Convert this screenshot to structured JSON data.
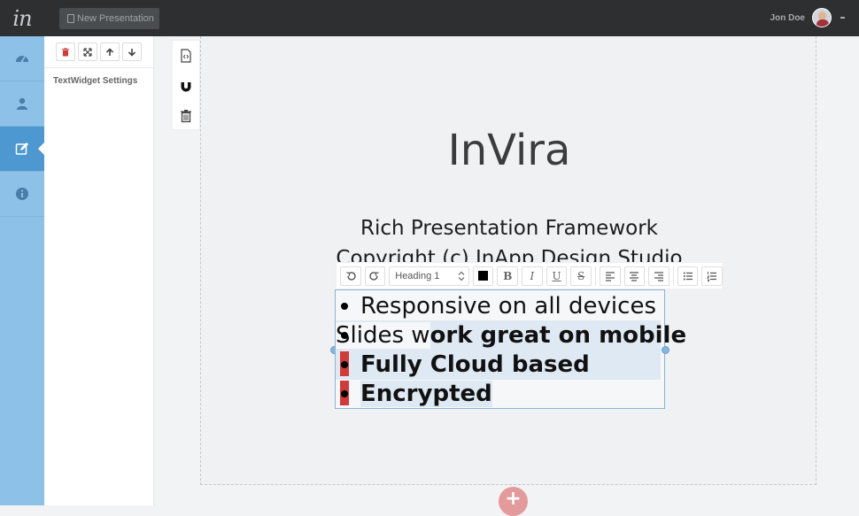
{
  "app": {
    "logo_text": "in"
  },
  "topbar": {
    "new_presentation_label": "New Presentation",
    "user_name": "Jon Doe"
  },
  "nav": {
    "items": [
      {
        "icon": "dashboard-icon"
      },
      {
        "icon": "user-icon"
      },
      {
        "icon": "edit-icon",
        "active": true
      },
      {
        "icon": "info-icon"
      }
    ]
  },
  "settings": {
    "title": "TextWidget Settings"
  },
  "slide": {
    "title": "InVira",
    "subtitle_1": "Rich Presentation Framework",
    "subtitle_2": "Copyright (c) InApp Design Studio"
  },
  "editor": {
    "block_style": "Heading 1",
    "text_color": "#000000",
    "list": [
      {
        "normal": "Responsive on all devices",
        "bold": ""
      },
      {
        "normal": "Slides w",
        "bold": "ork great on mobile"
      },
      {
        "normal": "",
        "bold": "Fully Cloud based"
      },
      {
        "normal": "",
        "bold": "Encrypted"
      }
    ]
  },
  "colors": {
    "nav_bg": "#8ec1e8",
    "nav_active": "#4d98d0",
    "topbar": "#2d2f31",
    "danger": "#d23a3a"
  }
}
